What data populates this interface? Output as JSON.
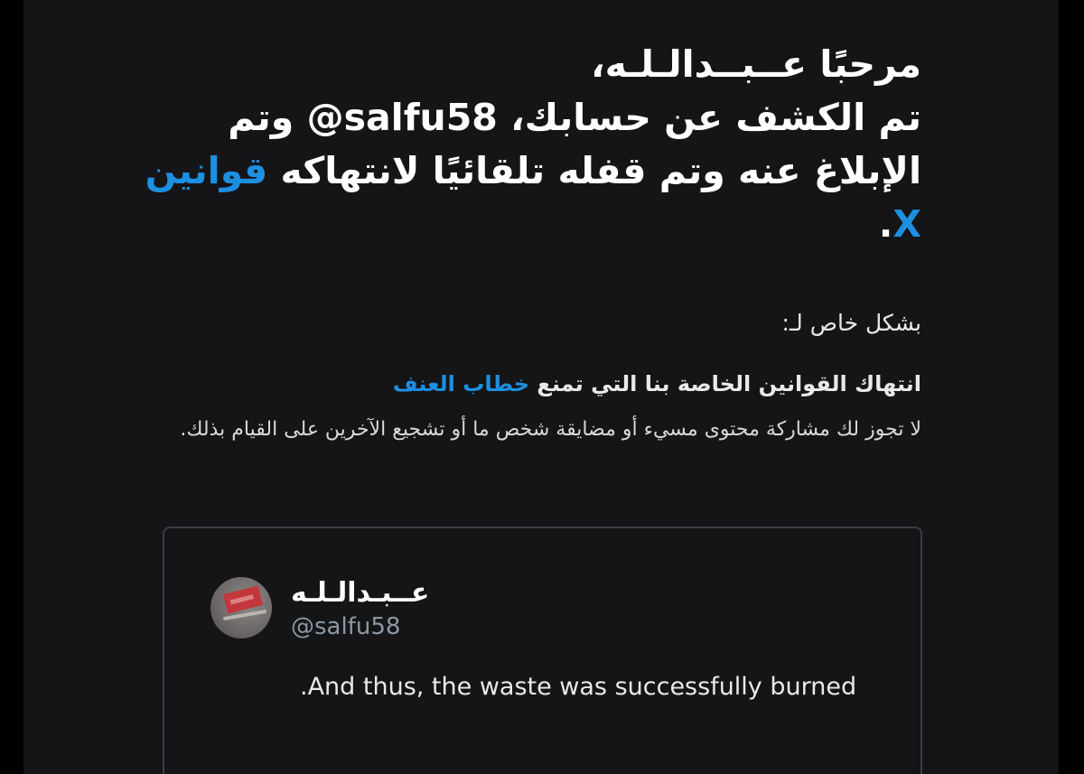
{
  "headline": {
    "greeting": "مرحبًا عــبــدالـلـه،",
    "line2_start": "تم الكشف عن حسابك، ",
    "handle": "@salfu58",
    "line2_end": " وتم الإبلاغ عنه وتم قفله تلقائيًا لانتهاكه ",
    "rules_link": "قوانين X",
    "end_punct": "."
  },
  "section_label": "بشكل خاص لـ:",
  "violation": {
    "title_prefix": "انتهاك القوانين الخاصة بنا التي تمنع ",
    "title_link": "خطاب العنف",
    "description": "لا تجوز لك مشاركة محتوى مسيء أو مضايقة شخص ما أو تشجيع الآخرين على القيام بذلك."
  },
  "tweet": {
    "display_name": "عــبـدالـلـه",
    "handle": "@salfu58",
    "text": ".And thus, the waste was successfully burned",
    "avatar_icon": "avatar-flag-image"
  },
  "colors": {
    "background": "#151518",
    "link": "#1d8fe1",
    "text": "#ffffff",
    "muted": "#8b98a5"
  }
}
